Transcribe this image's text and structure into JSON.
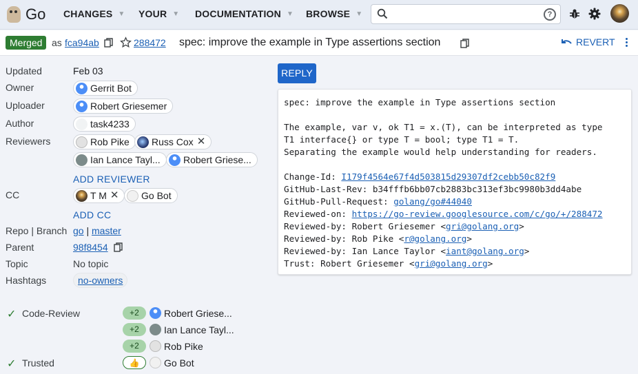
{
  "header": {
    "logo_text": "Go",
    "nav": [
      "CHANGES",
      "YOUR",
      "DOCUMENTATION",
      "BROWSE"
    ],
    "search_placeholder": ""
  },
  "change": {
    "status": "Merged",
    "as_label": "as",
    "commit": "fca94ab",
    "number": "288472",
    "subject": "spec: improve the example in Type assertions section",
    "revert_label": "REVERT"
  },
  "meta": {
    "updated_label": "Updated",
    "updated": "Feb 03",
    "owner_label": "Owner",
    "owner": "Gerrit Bot",
    "uploader_label": "Uploader",
    "uploader": "Robert Griesemer",
    "author_label": "Author",
    "author": "task4233",
    "reviewers_label": "Reviewers",
    "reviewers": [
      "Rob Pike",
      "Russ Cox",
      "Ian Lance Tayl...",
      "Robert Griese..."
    ],
    "add_reviewer": "ADD REVIEWER",
    "cc_label": "CC",
    "cc": [
      "T M",
      "Go Bot"
    ],
    "add_cc": "ADD CC",
    "repo_label": "Repo | Branch",
    "repo": "go",
    "branch_sep": "|",
    "branch": "master",
    "parent_label": "Parent",
    "parent": "98f8454",
    "topic_label": "Topic",
    "topic": "No topic",
    "hashtags_label": "Hashtags",
    "hashtag": "no-owners"
  },
  "labels": {
    "code_review": "Code-Review",
    "trusted": "Trusted",
    "votes": [
      {
        "value": "+2",
        "name": "Robert Griese..."
      },
      {
        "value": "+2",
        "name": "Ian Lance Tayl..."
      },
      {
        "value": "+2",
        "name": "Rob Pike"
      }
    ],
    "trusted_vote": {
      "value": "👍",
      "name": "Go Bot"
    }
  },
  "reply_label": "REPLY",
  "message": {
    "l1": "spec: improve the example in Type assertions section",
    "l2": "The example, var v, ok T1 = x.(T), can be interpreted as type",
    "l3": "T1 interface{} or type T = bool; type T1 = T.",
    "l4": "Separating the example would help understanding for readers.",
    "change_id_prefix": "Change-Id: ",
    "change_id": "I179f4564e67f4d503815d29307df2cebb50c82f9",
    "last_rev": "GitHub-Last-Rev: b34fffb6bb07cb2883bc313ef3bc9980b3dd4abe",
    "pr_prefix": "GitHub-Pull-Request: ",
    "pr": "golang/go#44040",
    "reviewed_on_prefix": "Reviewed-on: ",
    "reviewed_on": "https://go-review.googlesource.com/c/go/+/288472",
    "rb1_prefix": "Reviewed-by: Robert Griesemer <",
    "rb1_email": "gri@golang.org",
    "rb2_prefix": "Reviewed-by: Rob Pike <",
    "rb2_email": "r@golang.org",
    "rb3_prefix": "Reviewed-by: Ian Lance Taylor <",
    "rb3_email": "iant@golang.org",
    "trust_prefix": "Trust: Robert Griesemer <",
    "trust_email": "gri@golang.org",
    "close": ">"
  }
}
